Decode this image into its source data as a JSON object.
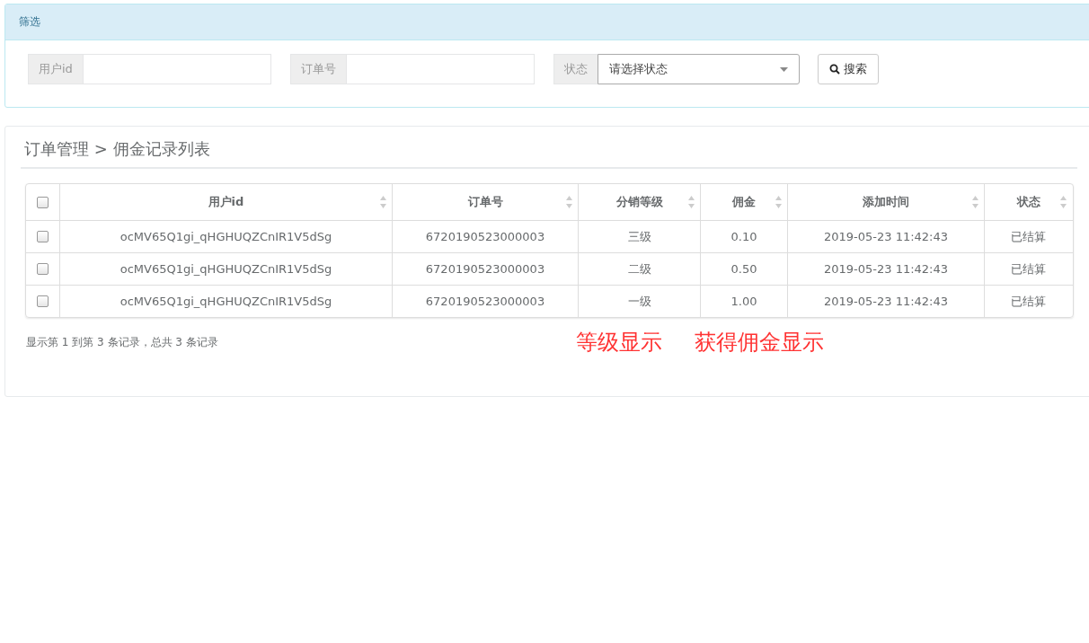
{
  "filter_panel": {
    "title": "筛选",
    "fields": [
      {
        "label": "用户id",
        "kind": "text"
      },
      {
        "label": "订单号",
        "kind": "text"
      },
      {
        "label": "状态",
        "kind": "select",
        "value": "请选择状态"
      }
    ],
    "search_button": "搜索"
  },
  "list_panel": {
    "breadcrumb": "订单管理 > 佣金记录列表",
    "table": {
      "select_all": {
        "checked": false
      },
      "columns": [
        "用户id",
        "订单号",
        "分销等级",
        "佣金",
        "添加时间",
        "状态"
      ],
      "rows": [
        {
          "checked": false,
          "cells": [
            "ocMV65Q1gi_qHGHUQZCnIR1V5dSg",
            "6720190523000003",
            "三级",
            "0.10",
            "2019-05-23 11:42:43",
            "已结算"
          ]
        },
        {
          "checked": false,
          "cells": [
            "ocMV65Q1gi_qHGHUQZCnIR1V5dSg",
            "6720190523000003",
            "二级",
            "0.50",
            "2019-05-23 11:42:43",
            "已结算"
          ]
        },
        {
          "checked": false,
          "cells": [
            "ocMV65Q1gi_qHGHUQZCnIR1V5dSg",
            "6720190523000003",
            "一级",
            "1.00",
            "2019-05-23 11:42:43",
            "已结算"
          ]
        }
      ]
    },
    "pagination_info": "显示第 1 到第 3 条记录，总共 3 条记录"
  },
  "annotations": [
    "等级显示",
    "获得佣金显示"
  ]
}
